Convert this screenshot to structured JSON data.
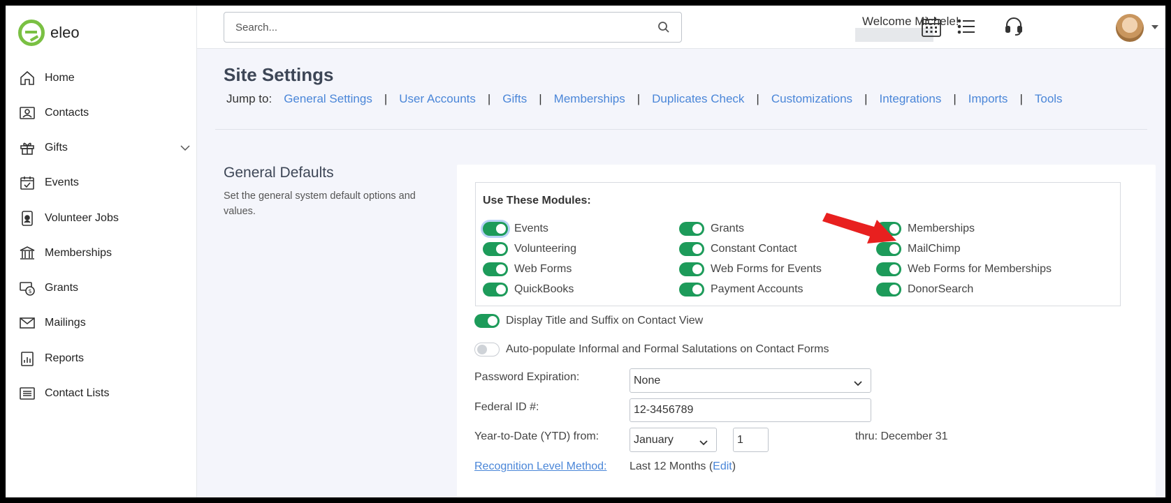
{
  "app": {
    "logo_text": "eleo"
  },
  "sidebar": {
    "items": [
      {
        "label": "Home",
        "icon": "home-icon"
      },
      {
        "label": "Contacts",
        "icon": "contacts-icon"
      },
      {
        "label": "Gifts",
        "icon": "gift-icon"
      },
      {
        "label": "Events",
        "icon": "calendar-check-icon"
      },
      {
        "label": "Volunteer Jobs",
        "icon": "volunteer-badge-icon"
      },
      {
        "label": "Memberships",
        "icon": "bank-building-icon"
      },
      {
        "label": "Grants",
        "icon": "grant-money-icon"
      },
      {
        "label": "Mailings",
        "icon": "envelope-icon"
      },
      {
        "label": "Reports",
        "icon": "report-chart-icon"
      },
      {
        "label": "Contact Lists",
        "icon": "list-icon"
      }
    ]
  },
  "topbar": {
    "search_placeholder": "Search...",
    "welcome": "Welcome Michele!",
    "icons": [
      "calendar-grid-icon",
      "list-view-icon",
      "headset-icon",
      "avatar"
    ]
  },
  "page": {
    "title": "Site Settings",
    "jump_label": "Jump to:",
    "jump_links": [
      "General Settings",
      "User Accounts",
      "Gifts",
      "Memberships",
      "Duplicates Check",
      "Customizations",
      "Integrations",
      "Imports",
      "Tools"
    ]
  },
  "general_defaults": {
    "title": "General Defaults",
    "description": "Set the general system default options and values.",
    "modules_title": "Use These Modules:",
    "modules": [
      {
        "label": "Events",
        "on": true
      },
      {
        "label": "Grants",
        "on": true
      },
      {
        "label": "Memberships",
        "on": true
      },
      {
        "label": "Volunteering",
        "on": true
      },
      {
        "label": "Constant Contact",
        "on": true
      },
      {
        "label": "MailChimp",
        "on": true
      },
      {
        "label": "Web Forms",
        "on": true
      },
      {
        "label": "Web Forms for Events",
        "on": true
      },
      {
        "label": "Web Forms for Memberships",
        "on": true
      },
      {
        "label": "QuickBooks",
        "on": true
      },
      {
        "label": "Payment Accounts",
        "on": true
      },
      {
        "label": "DonorSearch",
        "on": true
      }
    ],
    "display_title_suffix": {
      "label": "Display Title and Suffix on Contact View",
      "on": true
    },
    "auto_populate": {
      "label": "Auto-populate Informal and Formal Salutations on Contact Forms",
      "on": false
    },
    "password_expiration": {
      "label": "Password Expiration:",
      "value": "None"
    },
    "federal_id": {
      "label": "Federal ID #:",
      "value": "12-3456789"
    },
    "ytd": {
      "label": "Year-to-Date (YTD) from:",
      "month": "January",
      "day": "1",
      "thru": "thru: December 31"
    },
    "recognition": {
      "label": "Recognition Level Method:",
      "value": "Last 12 Months (",
      "edit": "Edit",
      "close": ")"
    }
  },
  "colors": {
    "accent": "#4a86d8",
    "toggle_on": "#1d9b5a",
    "arrow": "#e8201f",
    "logo": "#7ac043"
  }
}
